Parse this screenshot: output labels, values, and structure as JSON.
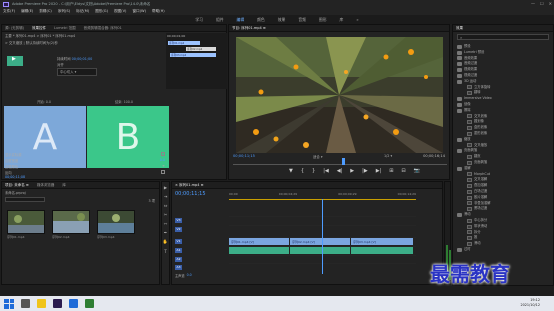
{
  "window": {
    "title": "Adobe Premiere Pro 2020 - C:\\用户\\Eldys\\文档\\Adobe\\Premiere Pro\\14.0\\未命名",
    "controls": [
      "—",
      "☐",
      "✕"
    ]
  },
  "menu": [
    "文件(F)",
    "编辑(E)",
    "剪辑(C)",
    "序列(S)",
    "标记(M)",
    "图形(G)",
    "视图(V)",
    "窗口(W)",
    "帮助(H)"
  ],
  "workspaces": {
    "items": [
      "学习",
      "组件",
      "编辑",
      "颜色",
      "效果",
      "音频",
      "图形",
      "库",
      "»"
    ],
    "active_index": 2
  },
  "source_panel": {
    "tabs": [
      "源: (无剪辑)",
      "效果控件",
      "Lumetri 范围",
      "音频剪辑混合器: 序列01"
    ],
    "active_tab_index": 1,
    "clip_path": "主要 * 序列01.mp4 > 序列01 * 序列01.mp4",
    "effect_title": "> 交叉缩放 | 默认持续时间为(2)秒",
    "duration_label": "持续时间",
    "duration_value": "00;00;01;00",
    "align_label": "对齐",
    "align_value": "中心切入",
    "start_label": "开始: 0.0",
    "end_label": "结束: 100.0",
    "a_letter": "A",
    "b_letter": "B",
    "mini_tc": "00;00;01;00",
    "mini_clips": [
      "序列01.mp4",
      "序列02.mp4",
      "序列03.mp4"
    ],
    "rows": [
      {
        "label": "显示实际源",
        "checked": false
      },
      {
        "label": "边框宽度",
        "value": "0.0"
      },
      {
        "label": "边框颜色"
      },
      {
        "label": "反向",
        "checked": false
      }
    ],
    "bottom_tc": "00;00;11;08"
  },
  "program_panel": {
    "title": "节目: 序列01.mp4 ≡",
    "tc_left": "00;00;11;15",
    "fit": "适合",
    "fraction": "1/2",
    "tc_right": "00;00;16;14",
    "playback_controls": [
      "▼",
      "{",
      "}",
      "|◀",
      "◀|",
      "▶",
      "|▶",
      "▶|",
      "⊞",
      "⊟",
      "📷"
    ]
  },
  "effects_panel": {
    "title": "效果",
    "search_placeholder": "",
    "tree": [
      {
        "label": "预设",
        "type": "folder"
      },
      {
        "label": "Lumetri 预设",
        "type": "folder"
      },
      {
        "label": "音频效果",
        "type": "folder"
      },
      {
        "label": "音频过渡",
        "type": "folder"
      },
      {
        "label": "视频效果",
        "type": "folder"
      },
      {
        "label": "视频过渡",
        "type": "folder"
      },
      {
        "label": "3D 运动",
        "type": "folder"
      },
      {
        "label": "立方体旋转",
        "type": "fx"
      },
      {
        "label": "翻转",
        "type": "fx"
      },
      {
        "label": "Immersive Video",
        "type": "folder"
      },
      {
        "label": "划像",
        "type": "folder"
      },
      {
        "label": "擦除",
        "type": "folder"
      },
      {
        "label": "交叉划像",
        "type": "fx"
      },
      {
        "label": "圆划像",
        "type": "fx"
      },
      {
        "label": "盒形划像",
        "type": "fx"
      },
      {
        "label": "菱形划像",
        "type": "fx"
      },
      {
        "label": "缩放",
        "type": "folder"
      },
      {
        "label": "交叉缩放",
        "type": "fx"
      },
      {
        "label": "页面剥落",
        "type": "folder"
      },
      {
        "label": "翻页",
        "type": "fx"
      },
      {
        "label": "页面剥落",
        "type": "fx"
      },
      {
        "label": "溶解",
        "type": "folder"
      },
      {
        "label": "MorphCut",
        "type": "fx"
      },
      {
        "label": "交叉溶解",
        "type": "fx"
      },
      {
        "label": "叠加溶解",
        "type": "fx"
      },
      {
        "label": "白场过渡",
        "type": "fx"
      },
      {
        "label": "胶片溶解",
        "type": "fx"
      },
      {
        "label": "非叠加溶解",
        "type": "fx"
      },
      {
        "label": "黑场过渡",
        "type": "fx"
      },
      {
        "label": "滑动",
        "type": "folder"
      },
      {
        "label": "中心拆分",
        "type": "fx"
      },
      {
        "label": "带状滑动",
        "type": "fx"
      },
      {
        "label": "拆分",
        "type": "fx"
      },
      {
        "label": "推",
        "type": "fx"
      },
      {
        "label": "滑动",
        "type": "fx"
      },
      {
        "label": "过时",
        "type": "folder"
      }
    ]
  },
  "project_panel": {
    "tabs": [
      "项目: 未命名 ≡",
      "媒体浏览器",
      "库"
    ],
    "project_file": "未命名.prproj",
    "item_count": "3 项",
    "items": [
      {
        "name": "序列01.mp4",
        "dur": "16;14"
      },
      {
        "name": "序列02.mp4",
        "dur": "16;14"
      },
      {
        "name": "序列03.mp4",
        "dur": "16;14"
      }
    ]
  },
  "tools": [
    "▶",
    "⇥",
    "⇔",
    "✂",
    "⇿",
    "✒",
    "✋",
    "T"
  ],
  "timeline": {
    "tab": "× 序列01.mp4 ≡",
    "timecode": "00;00;11;15",
    "ruler": [
      "00;00",
      "00;00;04;29",
      "00;00;09;29",
      "00;00;14;29"
    ],
    "video_tracks": [
      "V3",
      "V2",
      "V1"
    ],
    "audio_tracks": [
      "A1",
      "A2",
      "A3"
    ],
    "master_label": "主声道",
    "master_value": "0.0",
    "v1_clips": [
      "序列01.mp4 [V]",
      "序列02.mp4 [V]",
      "序列03.mp4 [V]"
    ]
  },
  "watermark": "最需教育",
  "taskbar": {
    "time": "19:12",
    "date": "2021/10/12"
  },
  "colors": {
    "accent": "#4e9cff",
    "clip_video": "#7ba6e0",
    "clip_audio": "#3cae88",
    "a_color": "#7da8d9",
    "b_color": "#3bc78a",
    "watermark": "#2a33c4"
  }
}
